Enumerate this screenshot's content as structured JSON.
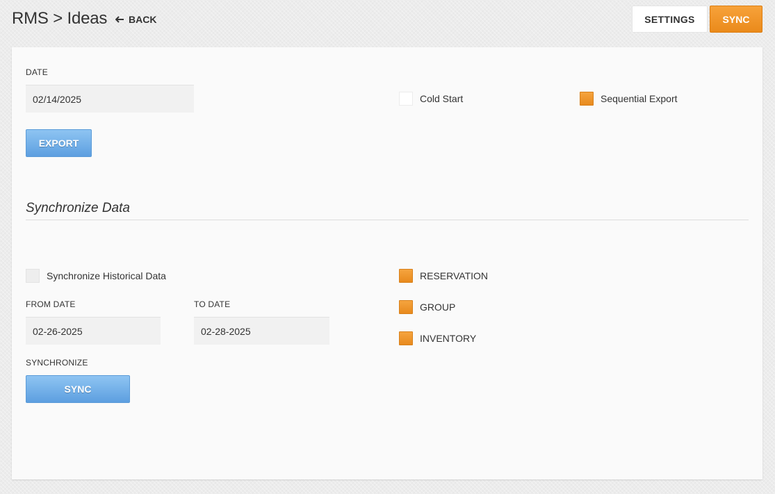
{
  "header": {
    "title": "RMS > Ideas",
    "back_label": "BACK",
    "settings_label": "SETTINGS",
    "sync_label": "SYNC"
  },
  "export_section": {
    "date_label": "DATE",
    "date_value": "02/14/2025",
    "export_label": "EXPORT",
    "cold_start_label": "Cold Start",
    "cold_start_checked": false,
    "sequential_export_label": "Sequential Export",
    "sequential_export_checked": true
  },
  "sync_section": {
    "title": "Synchronize Data",
    "historical_label": "Synchronize Historical Data",
    "historical_checked": false,
    "from_date_label": "FROM DATE",
    "from_date_value": "02-26-2025",
    "to_date_label": "TO DATE",
    "to_date_value": "02-28-2025",
    "synchronize_label": "SYNCHRONIZE",
    "sync_button_label": "SYNC",
    "options": [
      {
        "label": "RESERVATION",
        "checked": true
      },
      {
        "label": "GROUP",
        "checked": true
      },
      {
        "label": "INVENTORY",
        "checked": true
      }
    ]
  },
  "colors": {
    "accent_orange": "#ea8a1b",
    "button_blue": "#5d9fe0"
  }
}
